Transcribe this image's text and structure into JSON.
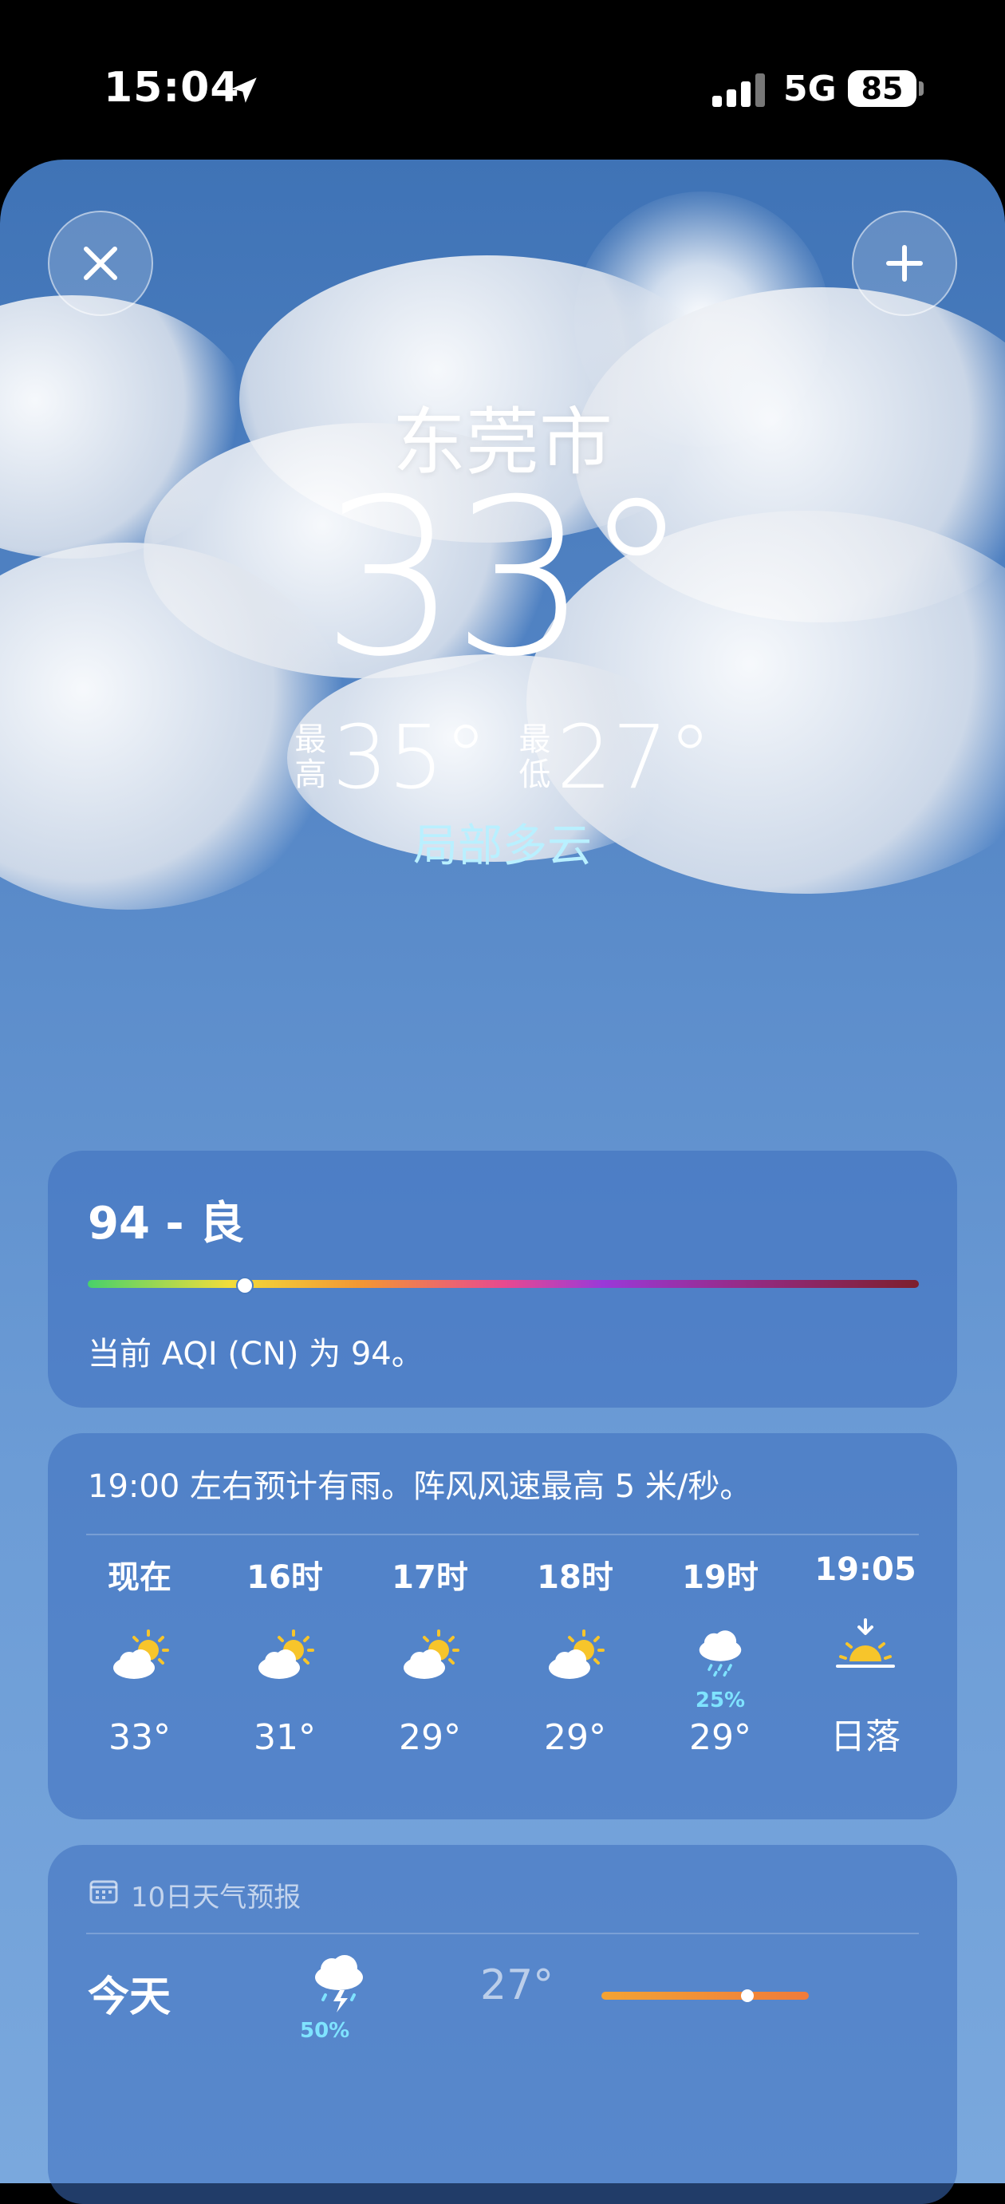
{
  "status_bar": {
    "time": "15:04",
    "network": "5G",
    "battery": "85"
  },
  "header": {
    "close_icon": "close-icon",
    "add_icon": "plus-icon"
  },
  "current": {
    "city": "东莞市",
    "temperature": "33°",
    "high_label": "最高",
    "high": "35°",
    "low_label": "最低",
    "low": "27°",
    "condition": "局部多云"
  },
  "aqi": {
    "title": "94 - 良",
    "value": 94,
    "description": "当前 AQI (CN) 为 94。",
    "colors": [
      "#48d16a",
      "#f2dd3a",
      "#f29634",
      "#e84a8e",
      "#9a39d8",
      "#7d1f2c"
    ]
  },
  "hourly": {
    "summary": "19:00 左右预计有雨。阵风风速最高 5 米/秒。",
    "items": [
      {
        "time": "现在",
        "icon": "partly-sunny-icon",
        "value": "33°"
      },
      {
        "time": "16时",
        "icon": "partly-sunny-icon",
        "value": "31°"
      },
      {
        "time": "17时",
        "icon": "partly-sunny-icon",
        "value": "29°"
      },
      {
        "time": "18时",
        "icon": "partly-sunny-icon",
        "value": "29°"
      },
      {
        "time": "19时",
        "icon": "rain-icon",
        "precip": "25%",
        "value": "29°"
      },
      {
        "time": "19:05",
        "icon": "sunset-icon",
        "value": "日落"
      }
    ]
  },
  "ten_day": {
    "title": "10日天气预报",
    "today": {
      "label": "今天",
      "icon": "thunderstorm-icon",
      "precip": "50%",
      "low": "27°"
    }
  }
}
